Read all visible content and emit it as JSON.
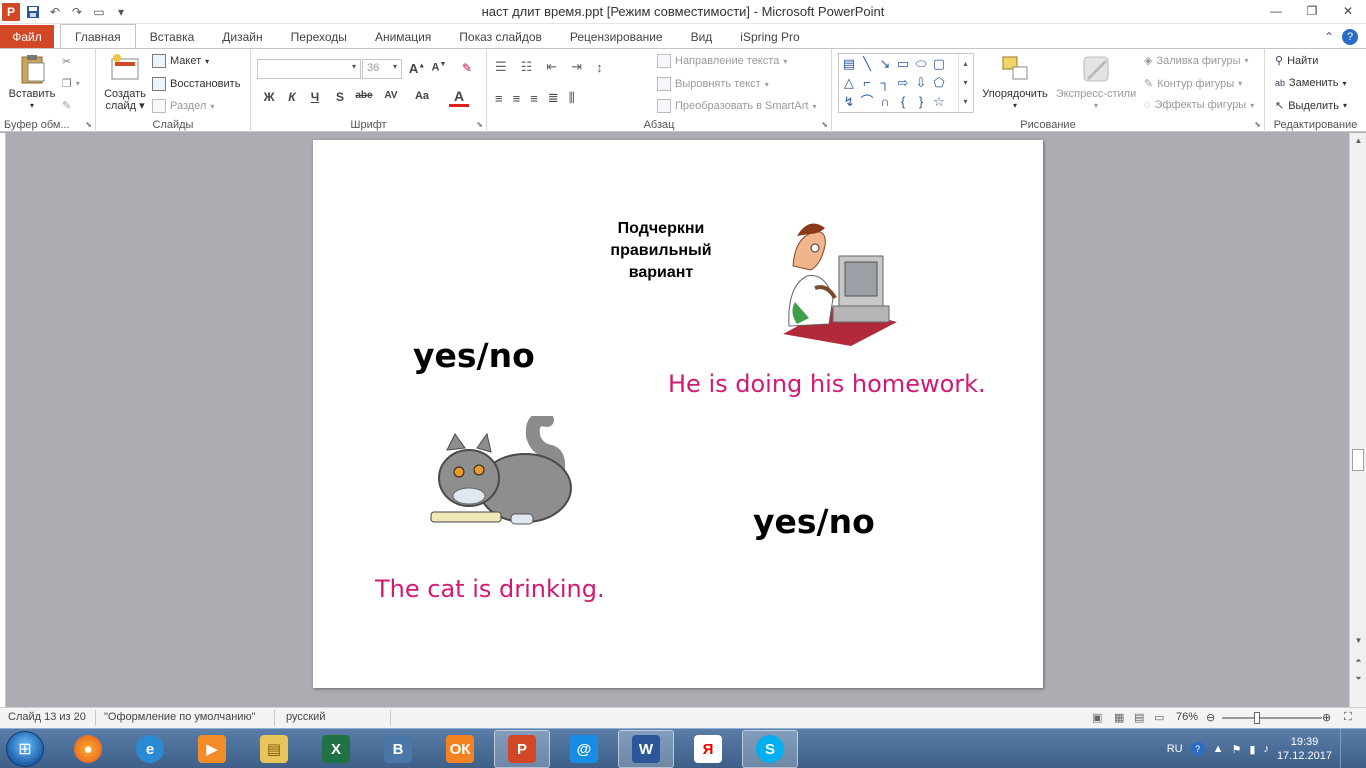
{
  "window": {
    "title": "наст длит время.ppt [Режим совместимости]  -  Microsoft PowerPoint",
    "qat_icons": [
      "powerpoint-icon",
      "save-icon",
      "undo-icon",
      "redo-icon",
      "new-slide-icon",
      "customize-icon"
    ]
  },
  "tabs": [
    {
      "label": "Файл"
    },
    {
      "label": "Главная"
    },
    {
      "label": "Вставка"
    },
    {
      "label": "Дизайн"
    },
    {
      "label": "Переходы"
    },
    {
      "label": "Анимация"
    },
    {
      "label": "Показ слайдов"
    },
    {
      "label": "Рецензирование"
    },
    {
      "label": "Вид"
    },
    {
      "label": "iSpring Pro"
    }
  ],
  "ribbon": {
    "clipboard": {
      "label": "Буфер обм...",
      "paste": "Вставить"
    },
    "slides": {
      "label": "Слайды",
      "new_slide_line1": "Создать",
      "new_slide_line2": "слайд",
      "layout": "Макет",
      "reset": "Восстановить",
      "section": "Раздел"
    },
    "font": {
      "label": "Шрифт",
      "size": "36",
      "bold": "Ж",
      "italic": "К",
      "underline": "Ч",
      "shadow": "S",
      "strike": "abe",
      "spacing": "AV",
      "case": "Aa",
      "color": "A"
    },
    "paragraph": {
      "label": "Абзац",
      "text_direction": "Направление текста",
      "align_text": "Выровнять текст",
      "smartart": "Преобразовать в SmartArt"
    },
    "drawing": {
      "label": "Рисование",
      "arrange": "Упорядочить",
      "quick_styles": "Экспресс-стили",
      "fill": "Заливка фигуры",
      "outline": "Контур фигуры",
      "effects": "Эффекты фигуры"
    },
    "editing": {
      "label": "Редактирование",
      "find": "Найти",
      "replace": "Заменить",
      "select": "Выделить"
    }
  },
  "slide": {
    "instruction": "Подчеркни\nправильный\nвариант",
    "yesno_1": "yes/no",
    "sentence_1": "He is doing his homework.",
    "yesno_2": "yes/no",
    "sentence_2": "The cat is drinking.",
    "sentence_color": "#d31a72"
  },
  "statusbar": {
    "slide_counter": "Слайд 13 из 20",
    "theme": "\"Оформление по умолчанию\"",
    "language": "русский",
    "zoom": "76%"
  },
  "taskbar": {
    "apps": [
      "firefox-icon",
      "ie-icon",
      "media-player-icon",
      "file-explorer-icon",
      "excel-icon",
      "vk-icon",
      "odnoklassniki-icon",
      "powerpoint-icon",
      "mail-icon",
      "word-icon",
      "yandex-icon",
      "skype-icon"
    ],
    "language": "RU",
    "time": "19:39",
    "date": "17.12.2017"
  }
}
